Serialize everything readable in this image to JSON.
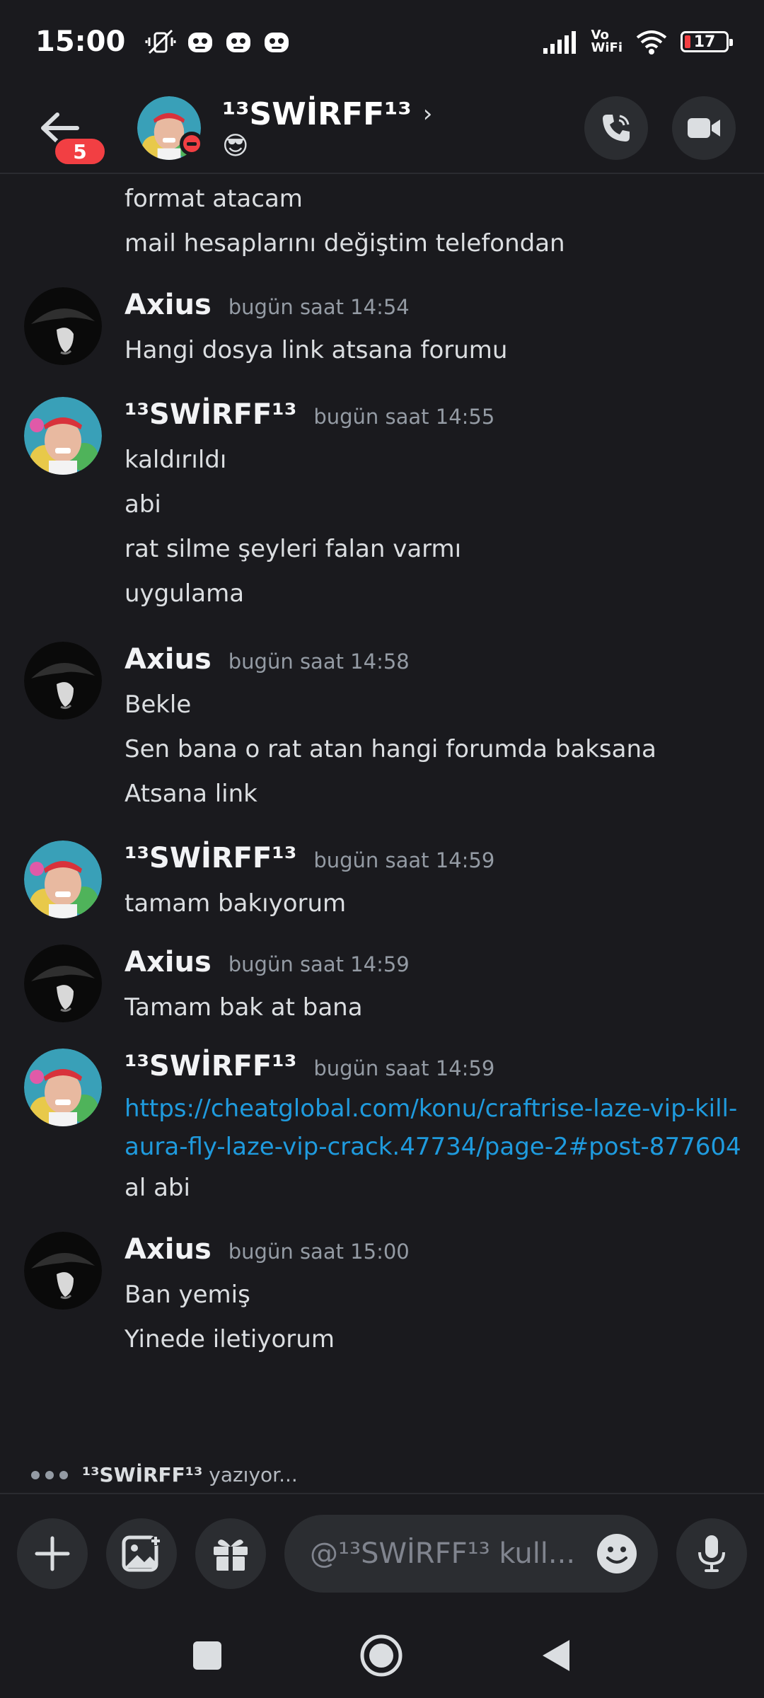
{
  "status_bar": {
    "time": "15:00",
    "volte": "Vo\nWiFi",
    "battery": "17"
  },
  "header": {
    "back_badge": "5",
    "user_name": "¹³SWİRFF¹³",
    "chevron": "›",
    "status_emoji": "😎"
  },
  "messages": {
    "continuation": [
      "format atacam",
      "mail hesaplarını değiştim telefondan"
    ],
    "groups": [
      {
        "author": "Axius",
        "time": "bugün saat 14:54",
        "lines": [
          "Hangi dosya link atsana forumu"
        ]
      },
      {
        "author": "¹³SWİRFF¹³",
        "time": "bugün saat 14:55",
        "lines": [
          "kaldırıldı",
          "abi",
          "rat silme şeyleri falan varmı",
          "uygulama"
        ]
      },
      {
        "author": "Axius",
        "time": "bugün saat 14:58",
        "lines": [
          "Bekle",
          "Sen bana o rat atan hangi forumda baksana",
          "Atsana link"
        ]
      },
      {
        "author": "¹³SWİRFF¹³",
        "time": "bugün saat 14:59",
        "lines": [
          "tamam bakıyorum"
        ]
      },
      {
        "author": "Axius",
        "time": "bugün saat 14:59",
        "lines": [
          "Tamam bak at bana"
        ]
      },
      {
        "author": "¹³SWİRFF¹³",
        "time": "bugün saat 14:59",
        "link": "https://cheatglobal.com/konu/craftrise-laze-vip-kill-aura-fly-laze-vip-crack.47734/page-2#post-877604",
        "lines": [
          "al abi"
        ]
      },
      {
        "author": "Axius",
        "time": "bugün saat 15:00",
        "lines": [
          "Ban yemiş",
          "Yinede iletiyorum"
        ]
      }
    ]
  },
  "typing": {
    "name": "¹³SWİRFF¹³",
    "suffix": " yazıyor..."
  },
  "composer": {
    "placeholder": "@¹³SWİRFF¹³ kull..."
  },
  "colors": {
    "background": "#1a1a1e",
    "link": "#1f9bde",
    "badge": "#f23f43",
    "button_bg": "#2b2d31"
  }
}
